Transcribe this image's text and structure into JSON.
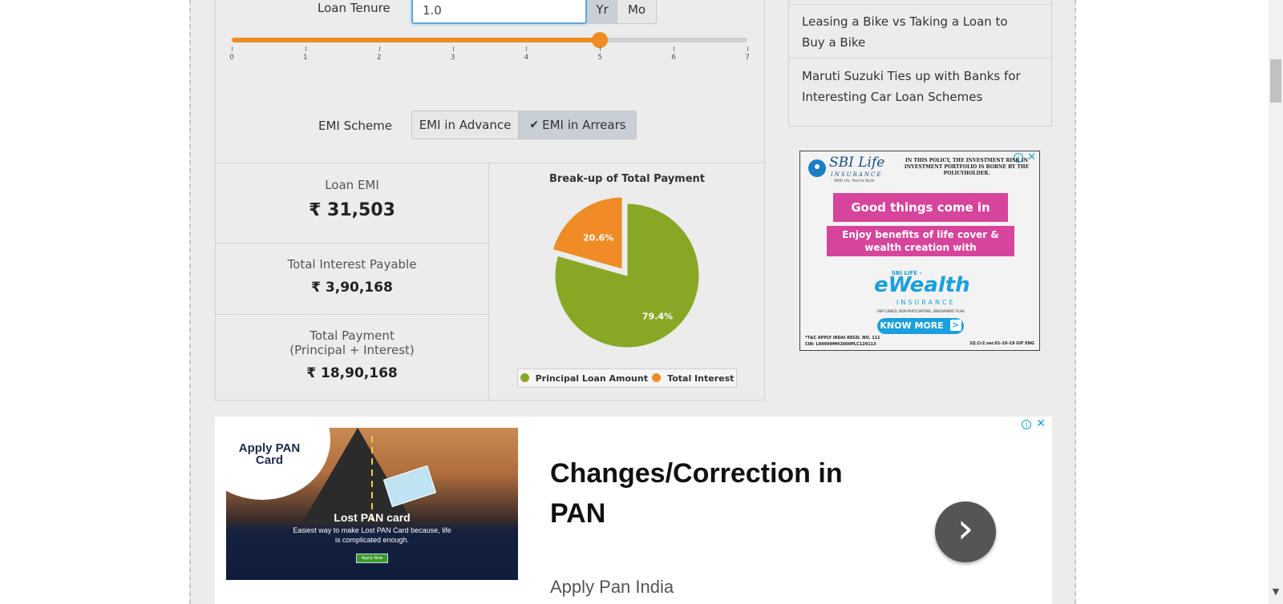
{
  "calculator": {
    "loan_tenure_label": "Loan Tenure",
    "loan_tenure_value": "1.0",
    "unit_year": "Yr",
    "unit_month": "Mo",
    "slider_ticks": [
      "0",
      "1",
      "2",
      "3",
      "4",
      "5",
      "6",
      "7"
    ],
    "slider_value": 5,
    "slider_max": 7,
    "emi_scheme_label": "EMI Scheme",
    "emi_advance_label": "EMI in Advance",
    "emi_arrears_label": "EMI in Arrears",
    "emi_arrears_check": "✔"
  },
  "results": {
    "loan_emi_label": "Loan EMI",
    "loan_emi_value": "₹ 31,503",
    "interest_label": "Total Interest Payable",
    "interest_value": "₹ 3,90,168",
    "total_label_line1": "Total Payment",
    "total_label_line2": "(Principal + Interest)",
    "total_value": "₹ 18,90,168"
  },
  "chart_data": {
    "type": "pie",
    "title": "Break-up of Total Payment",
    "labels": [
      "Principal Loan Amount",
      "Total Interest"
    ],
    "values": [
      79.4,
      20.6
    ],
    "value_labels": [
      "79.4%",
      "20.6%"
    ],
    "colors": [
      "#88a825",
      "#ef8c25"
    ],
    "legend_position": "bottom"
  },
  "related": {
    "items": [
      "Leasing a Bike vs Taking a Loan to Buy a Bike",
      "Maruti Suzuki Ties up with Banks for Interesting Car Loan Schemes"
    ]
  },
  "ad_sbi": {
    "brand": "SBI Life",
    "brand_sub": "INSURANCE",
    "tagline": "With Us, You're Sure",
    "disclaimer": "IN THIS POLICY, THE INVESTMENT RISK IN INVESTMENT PORTFOLIO IS BORNE BY THE POLICYHOLDER.",
    "headline": "Good things come in pairs!",
    "subline": "Enjoy benefits of life cover & wealth creation with",
    "product_prefix": "SBI LIFE -",
    "product": "eWealth",
    "product_sub": "INSURANCE",
    "product_desc": "UNIT-LINKED, NON-PARTICIPATING, ENDOWMENT PLAN",
    "cta": "KNOW MORE",
    "footer_left": "*T&C APPLY  IRDAI REGD. NO. 111",
    "footer_left2": "CIN: L99999MH2000PLC129113",
    "footer_right": "1Q.Cr2.ver.01-10-19 GIF ENG"
  },
  "ad_pan": {
    "image_title": "Apply PAN Card",
    "image_subtitle": "Lost PAN card",
    "image_body": "Easiest way to make Lost PAN Card because, life is complicated enough.",
    "image_button": "Apply Now",
    "headline": "Changes/Correction in PAN",
    "advertiser": "Apply Pan India",
    "next_glyph": "›"
  },
  "colors": {
    "accent_orange": "#ef8c25",
    "principal_green": "#88a825",
    "input_focus": "#5aa8e6"
  }
}
